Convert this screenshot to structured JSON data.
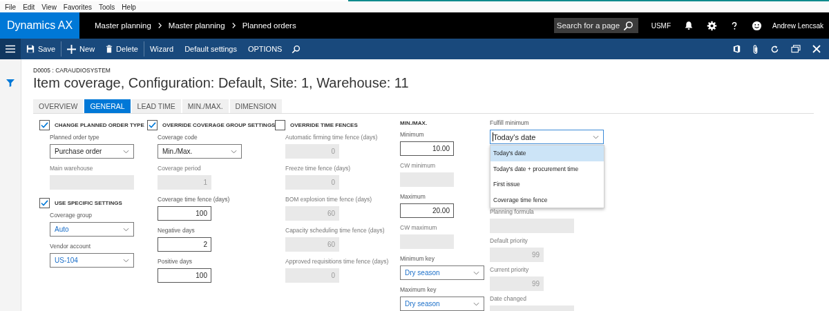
{
  "menu_bar": [
    "File",
    "Edit",
    "View",
    "Favorites",
    "Tools",
    "Help"
  ],
  "header": {
    "app_name": "Dynamics AX",
    "breadcrumb": [
      "Master planning",
      "Master planning",
      "Planned orders"
    ],
    "search": {
      "placeholder": "Search for a page"
    },
    "company": "USMF",
    "user": "Andrew Lencsak"
  },
  "toolbar": {
    "actions": [
      {
        "kind": "save",
        "label": "Save"
      },
      {
        "kind": "new",
        "label": "New"
      },
      {
        "kind": "delete",
        "label": "Delete"
      },
      {
        "kind": "plain",
        "label": "Wizard"
      },
      {
        "kind": "plain",
        "label": "Default settings"
      },
      {
        "kind": "plain",
        "label": "OPTIONS"
      }
    ]
  },
  "record": {
    "caption": "D0005 : CARAUDIOSYSTEM",
    "title": "Item coverage, Configuration: Default, Site: 1, Warehouse: 11"
  },
  "tabs": [
    {
      "label": "OVERVIEW",
      "selected": false
    },
    {
      "label": "GENERAL",
      "selected": true
    },
    {
      "label": "LEAD TIME",
      "selected": false
    },
    {
      "label": "MIN./MAX.",
      "selected": false
    },
    {
      "label": "DIMENSION",
      "selected": false
    }
  ],
  "columns": [
    {
      "items": [
        {
          "kind": "checkbox",
          "label": "CHANGE PLANNED ORDER TYPE",
          "checked": true
        },
        {
          "kind": "dropdown",
          "label": "Planned order type",
          "value": "Purchase order",
          "lookup": false
        },
        {
          "kind": "text_input",
          "label": "Main warehouse",
          "disabled": true
        },
        {
          "kind": "checkbox",
          "label": "USE SPECIFIC SETTINGS",
          "checked": true
        },
        {
          "kind": "dropdown",
          "label": "Coverage group",
          "value": "Auto",
          "lookup": true
        },
        {
          "kind": "dropdown",
          "label": "Vendor account",
          "value": "US-104",
          "lookup": true
        }
      ]
    },
    {
      "items": [
        {
          "kind": "checkbox",
          "label": "OVERRIDE COVERAGE GROUP SETTINGS",
          "checked": true
        },
        {
          "kind": "dropdown",
          "label": "Coverage code",
          "value": "Min./Max.",
          "lookup": false
        },
        {
          "kind": "number_input",
          "label": "Coverage period",
          "value": "1",
          "disabled": true
        },
        {
          "kind": "number_input",
          "label": "Coverage time fence (days)",
          "value": "100",
          "disabled": false
        },
        {
          "kind": "number_input",
          "label": "Negative days",
          "value": "2",
          "disabled": false
        },
        {
          "kind": "number_input",
          "label": "Positive days",
          "value": "100",
          "disabled": false
        }
      ]
    },
    {
      "items": [
        {
          "kind": "checkbox",
          "label": "OVERRIDE TIME FENCES",
          "checked": false
        },
        {
          "kind": "number_input",
          "label": "Automatic firming time fence (days)",
          "value": "0",
          "disabled": true
        },
        {
          "kind": "number_input",
          "label": "Freeze time fence (days)",
          "value": "0",
          "disabled": true
        },
        {
          "kind": "number_input",
          "label": "BOM explosion time fence (days)",
          "value": "60",
          "disabled": true
        },
        {
          "kind": "number_input",
          "label": "Capacity scheduling time fence (days)",
          "value": "60",
          "disabled": true
        },
        {
          "kind": "number_input",
          "label": "Approved requisitions time fence (days)",
          "value": "0",
          "disabled": true
        }
      ]
    },
    {
      "items": [
        {
          "kind": "heading",
          "label": "MIN./MAX."
        },
        {
          "kind": "number_input",
          "label": "Minimum",
          "value": "10.00",
          "disabled": false
        },
        {
          "kind": "number_input",
          "label": "CW minimum",
          "disabled": true
        },
        {
          "kind": "number_input",
          "label": "Maximum",
          "value": "20.00",
          "disabled": false
        },
        {
          "kind": "number_input",
          "label": "CW maximum",
          "disabled": true
        },
        {
          "kind": "dropdown",
          "label": "Minimum key",
          "value": "Dry season",
          "lookup": true
        },
        {
          "kind": "dropdown",
          "label": "Maximum key",
          "value": "Dry season",
          "lookup": true
        }
      ]
    },
    {
      "items": [
        {
          "kind": "dropdown",
          "label": "Fulfill minimum",
          "value": "Today's date",
          "lookup": false,
          "open": true,
          "options": [
            {
              "label": "Today's date",
              "selected": true
            },
            {
              "label": "Today's date + procurement time",
              "selected": false
            },
            {
              "label": "First issue",
              "selected": false
            },
            {
              "label": "Coverage time fence",
              "selected": false
            }
          ]
        },
        {
          "kind": "text_input",
          "label": "Planning formula",
          "disabled": true
        },
        {
          "kind": "number_input",
          "label": "Default priority",
          "value": "99",
          "disabled": true
        },
        {
          "kind": "number_input",
          "label": "Current priority",
          "value": "99",
          "disabled": true
        },
        {
          "kind": "text_input",
          "label": "Date changed",
          "disabled": true
        }
      ]
    }
  ]
}
